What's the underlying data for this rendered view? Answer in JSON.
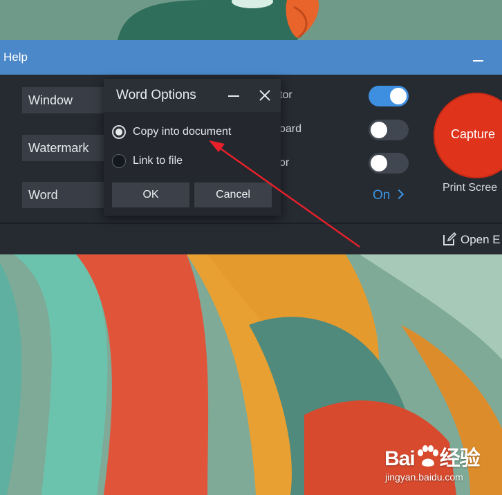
{
  "window": {
    "title": "Help"
  },
  "fields": [
    {
      "label": "Window"
    },
    {
      "label": "Watermark"
    },
    {
      "label": "Word"
    }
  ],
  "options": [
    {
      "label_fragment": "tor",
      "toggle": "on"
    },
    {
      "label_fragment": "oard",
      "toggle": "off"
    },
    {
      "label_fragment": "or",
      "toggle": "off"
    }
  ],
  "more_link": {
    "label": "On"
  },
  "capture": {
    "button_label": "Capture",
    "sub_label": "Print Scree"
  },
  "open_editor": {
    "label": "Open E"
  },
  "dialog": {
    "title": "Word Options",
    "radio_options": [
      {
        "label": "Copy into document",
        "checked": true
      },
      {
        "label": "Link to file",
        "checked": false
      }
    ],
    "ok_label": "OK",
    "cancel_label": "Cancel"
  },
  "watermark": {
    "brand": "Bai",
    "brand_suffix": "经验",
    "url": "jingyan.baidu.com"
  },
  "colors": {
    "accent_blue": "#4a88c9",
    "toggle_on": "#3f8fe0",
    "capture_red": "#e0331b",
    "arrow_red": "#e8202a"
  }
}
